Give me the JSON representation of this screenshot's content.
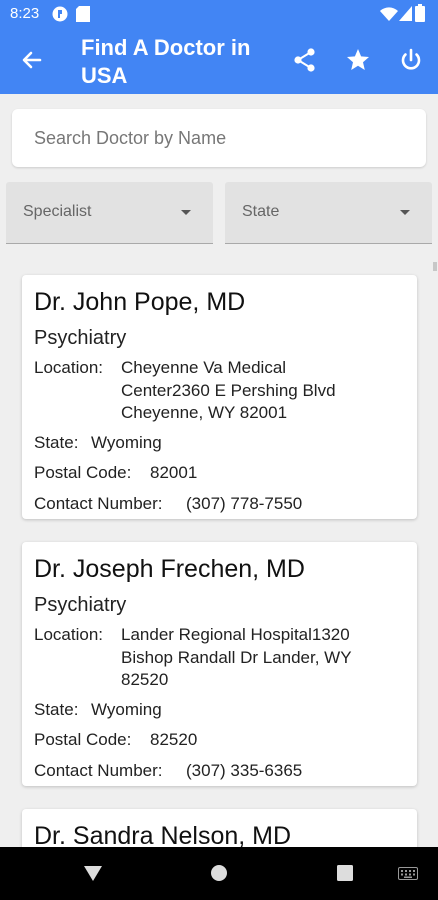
{
  "status_bar": {
    "time": "8:23"
  },
  "app_bar": {
    "title": "Find A Doctor in USA"
  },
  "search": {
    "placeholder": "Search Doctor by Name"
  },
  "filters": {
    "specialist": "Specialist",
    "state": "State"
  },
  "labels": {
    "location": "Location:",
    "state": "State:",
    "postal_code": "Postal Code:",
    "contact_number": "Contact Number:"
  },
  "doctors": [
    {
      "name": "Dr. John Pope, MD",
      "specialty": "Psychiatry",
      "location": "Cheyenne Va Medical Center2360 E Pershing Blvd Cheyenne, WY 82001",
      "state": "Wyoming",
      "postal_code": "82001",
      "contact_number": "(307) 778-7550"
    },
    {
      "name": "Dr. Joseph Frechen, MD",
      "specialty": "Psychiatry",
      "location": "Lander Regional Hospital1320 Bishop Randall Dr Lander, WY 82520",
      "state": "Wyoming",
      "postal_code": "82520",
      "contact_number": "(307) 335-6365"
    },
    {
      "name": "Dr. Sandra Nelson, MD"
    }
  ]
}
